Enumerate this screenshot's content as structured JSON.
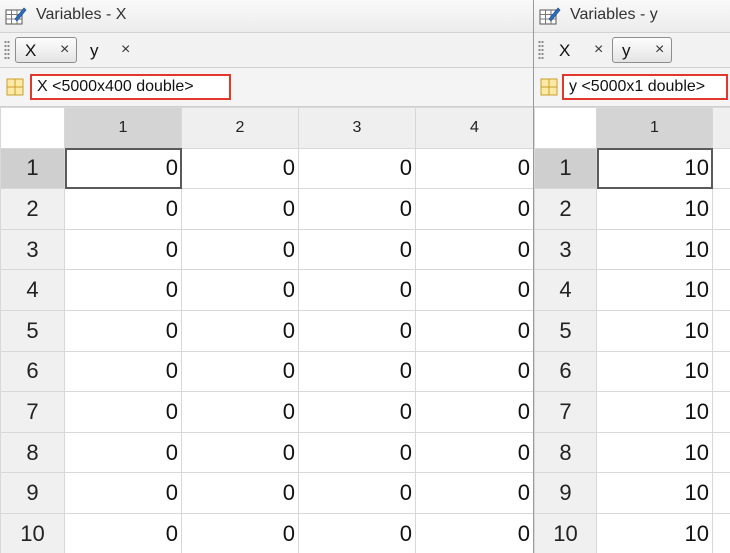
{
  "panels": [
    {
      "title": "Variables - X",
      "tabs": [
        {
          "label": "X",
          "close": "×",
          "active": true
        },
        {
          "label": "y",
          "close": "×",
          "active": false
        }
      ],
      "variable_info": "X <5000x400 double>",
      "columns": [
        "1",
        "2",
        "3",
        "4"
      ],
      "rows": [
        {
          "label": "1",
          "cells": [
            "0",
            "0",
            "0",
            "0"
          ]
        },
        {
          "label": "2",
          "cells": [
            "0",
            "0",
            "0",
            "0"
          ]
        },
        {
          "label": "3",
          "cells": [
            "0",
            "0",
            "0",
            "0"
          ]
        },
        {
          "label": "4",
          "cells": [
            "0",
            "0",
            "0",
            "0"
          ]
        },
        {
          "label": "5",
          "cells": [
            "0",
            "0",
            "0",
            "0"
          ]
        },
        {
          "label": "6",
          "cells": [
            "0",
            "0",
            "0",
            "0"
          ]
        },
        {
          "label": "7",
          "cells": [
            "0",
            "0",
            "0",
            "0"
          ]
        },
        {
          "label": "8",
          "cells": [
            "0",
            "0",
            "0",
            "0"
          ]
        },
        {
          "label": "9",
          "cells": [
            "0",
            "0",
            "0",
            "0"
          ]
        },
        {
          "label": "10",
          "cells": [
            "0",
            "0",
            "0",
            "0"
          ]
        }
      ]
    },
    {
      "title": "Variables - y",
      "tabs": [
        {
          "label": "X",
          "close": "×",
          "active": false
        },
        {
          "label": "y",
          "close": "×",
          "active": true
        }
      ],
      "variable_info": "y <5000x1 double>",
      "columns": [
        "1",
        ""
      ],
      "rows": [
        {
          "label": "1",
          "cells": [
            "10"
          ]
        },
        {
          "label": "2",
          "cells": [
            "10"
          ]
        },
        {
          "label": "3",
          "cells": [
            "10"
          ]
        },
        {
          "label": "4",
          "cells": [
            "10"
          ]
        },
        {
          "label": "5",
          "cells": [
            "10"
          ]
        },
        {
          "label": "6",
          "cells": [
            "10"
          ]
        },
        {
          "label": "7",
          "cells": [
            "10"
          ]
        },
        {
          "label": "8",
          "cells": [
            "10"
          ]
        },
        {
          "label": "9",
          "cells": [
            "10"
          ]
        },
        {
          "label": "10",
          "cells": [
            "10"
          ]
        }
      ]
    }
  ],
  "colors": {
    "highlight_border": "#e2382c",
    "header_background": "#efefef",
    "selected_header": "#cfcfcf"
  },
  "icons": {
    "title": "variable-editor-icon",
    "info": "grid-icon",
    "grip": "drag-grip-icon"
  }
}
